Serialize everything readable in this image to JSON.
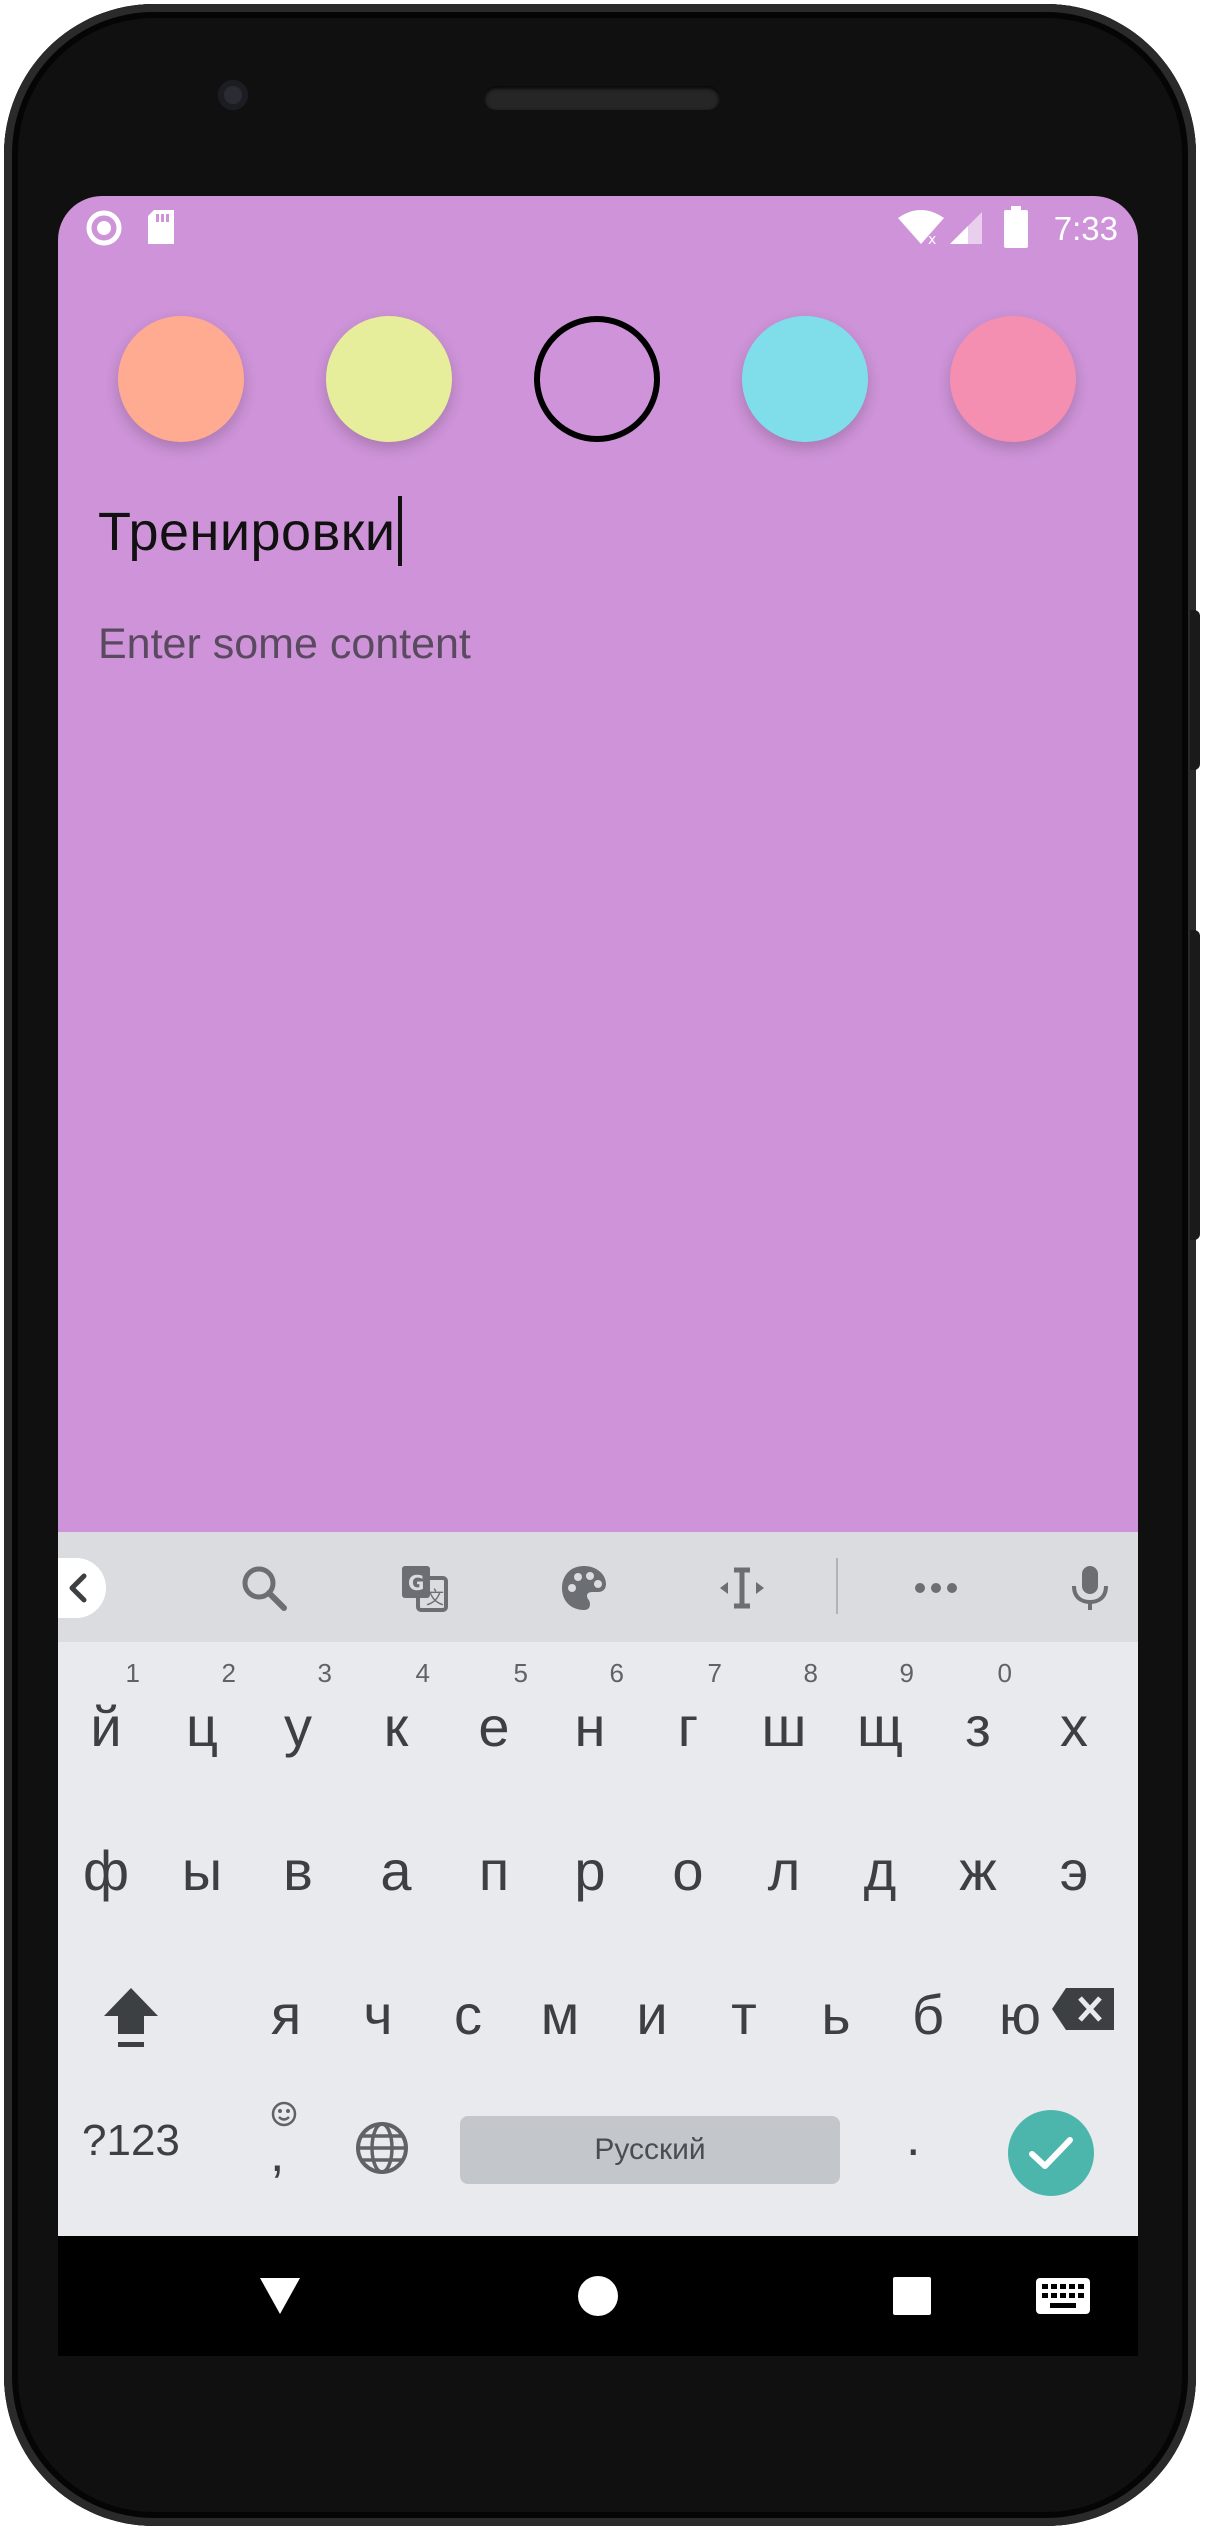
{
  "status_bar": {
    "time": "7:33",
    "left_icons": [
      "record-circle-icon",
      "sd-card-icon"
    ],
    "right_icons": [
      "wifi-icon",
      "cell-signal-icon",
      "battery-icon"
    ]
  },
  "color_picker": {
    "swatches": [
      {
        "name": "peach",
        "color": "#ffab91",
        "selected": false
      },
      {
        "name": "yellow",
        "color": "#e6ee9c",
        "selected": false
      },
      {
        "name": "purple",
        "color": "#ce93d8",
        "selected": true
      },
      {
        "name": "cyan",
        "color": "#80deea",
        "selected": false
      },
      {
        "name": "pink",
        "color": "#f48fb1",
        "selected": false
      }
    ]
  },
  "note": {
    "title_value": "Тренировки",
    "content_placeholder": "Enter some content",
    "background_color": "#ce93d8"
  },
  "keyboard": {
    "toolbar_icons": [
      "collapse-icon",
      "search-icon",
      "translate-icon",
      "palette-icon",
      "text-cursor-icon",
      "more-icon",
      "mic-icon"
    ],
    "row1": [
      {
        "ch": "й",
        "hint": "1"
      },
      {
        "ch": "ц",
        "hint": "2"
      },
      {
        "ch": "у",
        "hint": "3"
      },
      {
        "ch": "к",
        "hint": "4"
      },
      {
        "ch": "е",
        "hint": "5"
      },
      {
        "ch": "н",
        "hint": "6"
      },
      {
        "ch": "г",
        "hint": "7"
      },
      {
        "ch": "ш",
        "hint": "8"
      },
      {
        "ch": "щ",
        "hint": "9"
      },
      {
        "ch": "з",
        "hint": "0"
      },
      {
        "ch": "х",
        "hint": ""
      }
    ],
    "row2": [
      "ф",
      "ы",
      "в",
      "а",
      "п",
      "р",
      "о",
      "л",
      "д",
      "ж",
      "э"
    ],
    "row3": [
      "я",
      "ч",
      "с",
      "м",
      "и",
      "т",
      "ь",
      "б",
      "ю"
    ],
    "symbols_label": "?123",
    "comma_label": ",",
    "space_label": "Русский",
    "period_label": "."
  },
  "nav_bar": {
    "buttons": [
      "back-icon",
      "home-icon",
      "recents-icon",
      "keyboard-switch-icon"
    ]
  }
}
